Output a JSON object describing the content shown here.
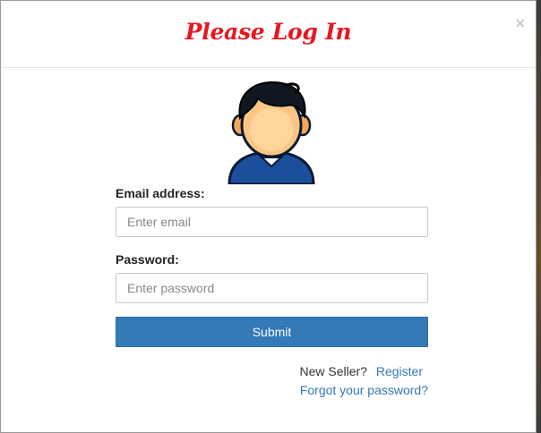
{
  "modal": {
    "title": "Please Log In",
    "close_glyph": "×",
    "avatar_icon": "user-avatar-icon"
  },
  "form": {
    "email": {
      "label": "Email address:",
      "placeholder": "Enter email",
      "value": ""
    },
    "password": {
      "label": "Password:",
      "placeholder": "Enter password",
      "value": ""
    },
    "submit_label": "Submit"
  },
  "footer": {
    "new_seller_text": "New Seller?",
    "register_label": "Register",
    "forgot_label": "Forgot your password?"
  },
  "colors": {
    "title": "#e8171f",
    "primary_button": "#337ab7",
    "link": "#337ab7"
  }
}
